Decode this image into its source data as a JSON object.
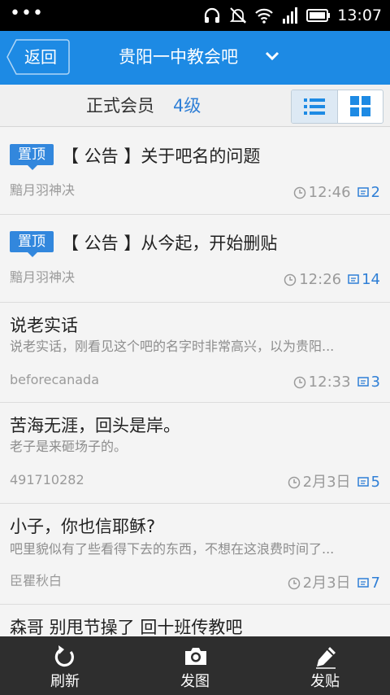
{
  "status_bar": {
    "time": "13:07"
  },
  "header": {
    "back_label": "返回",
    "title": "贵阳一中教会吧"
  },
  "member": {
    "label": "正式会员",
    "level": "4级"
  },
  "posts": [
    {
      "pinned": true,
      "pin_label": "置顶",
      "title": "【 公告 】关于吧名的问题",
      "author": "黯月羽神决",
      "time": "12:46",
      "replies": "2"
    },
    {
      "pinned": true,
      "pin_label": "置顶",
      "title": "【 公告 】从今起，开始删贴",
      "author": "黯月羽神决",
      "time": "12:26",
      "replies": "14"
    },
    {
      "pinned": false,
      "title": "说老实话",
      "excerpt": "说老实话，刚看见这个吧的名字时非常高兴，以为贵阳...",
      "author": "beforecanada",
      "time": "12:33",
      "replies": "3"
    },
    {
      "pinned": false,
      "title": "苦海无涯，回头是岸。",
      "excerpt": "老子是来砸场子的。",
      "author": "491710282",
      "time": "2月3日",
      "replies": "5"
    },
    {
      "pinned": false,
      "title": "小子，你也信耶稣?",
      "excerpt": "吧里貌似有了些看得下去的东西，不想在这浪费时间了...",
      "author": "臣瞿秋白",
      "time": "2月3日",
      "replies": "7"
    },
    {
      "pinned": false,
      "title": "森哥 别甩节操了 回十班传教吧"
    }
  ],
  "toolbar": {
    "refresh_label": "刷新",
    "photo_label": "发图",
    "post_label": "发贴"
  },
  "colors": {
    "accent": "#1d8ae4",
    "link": "#2f7fd6",
    "toolbar_bg": "#2e2e2e"
  }
}
